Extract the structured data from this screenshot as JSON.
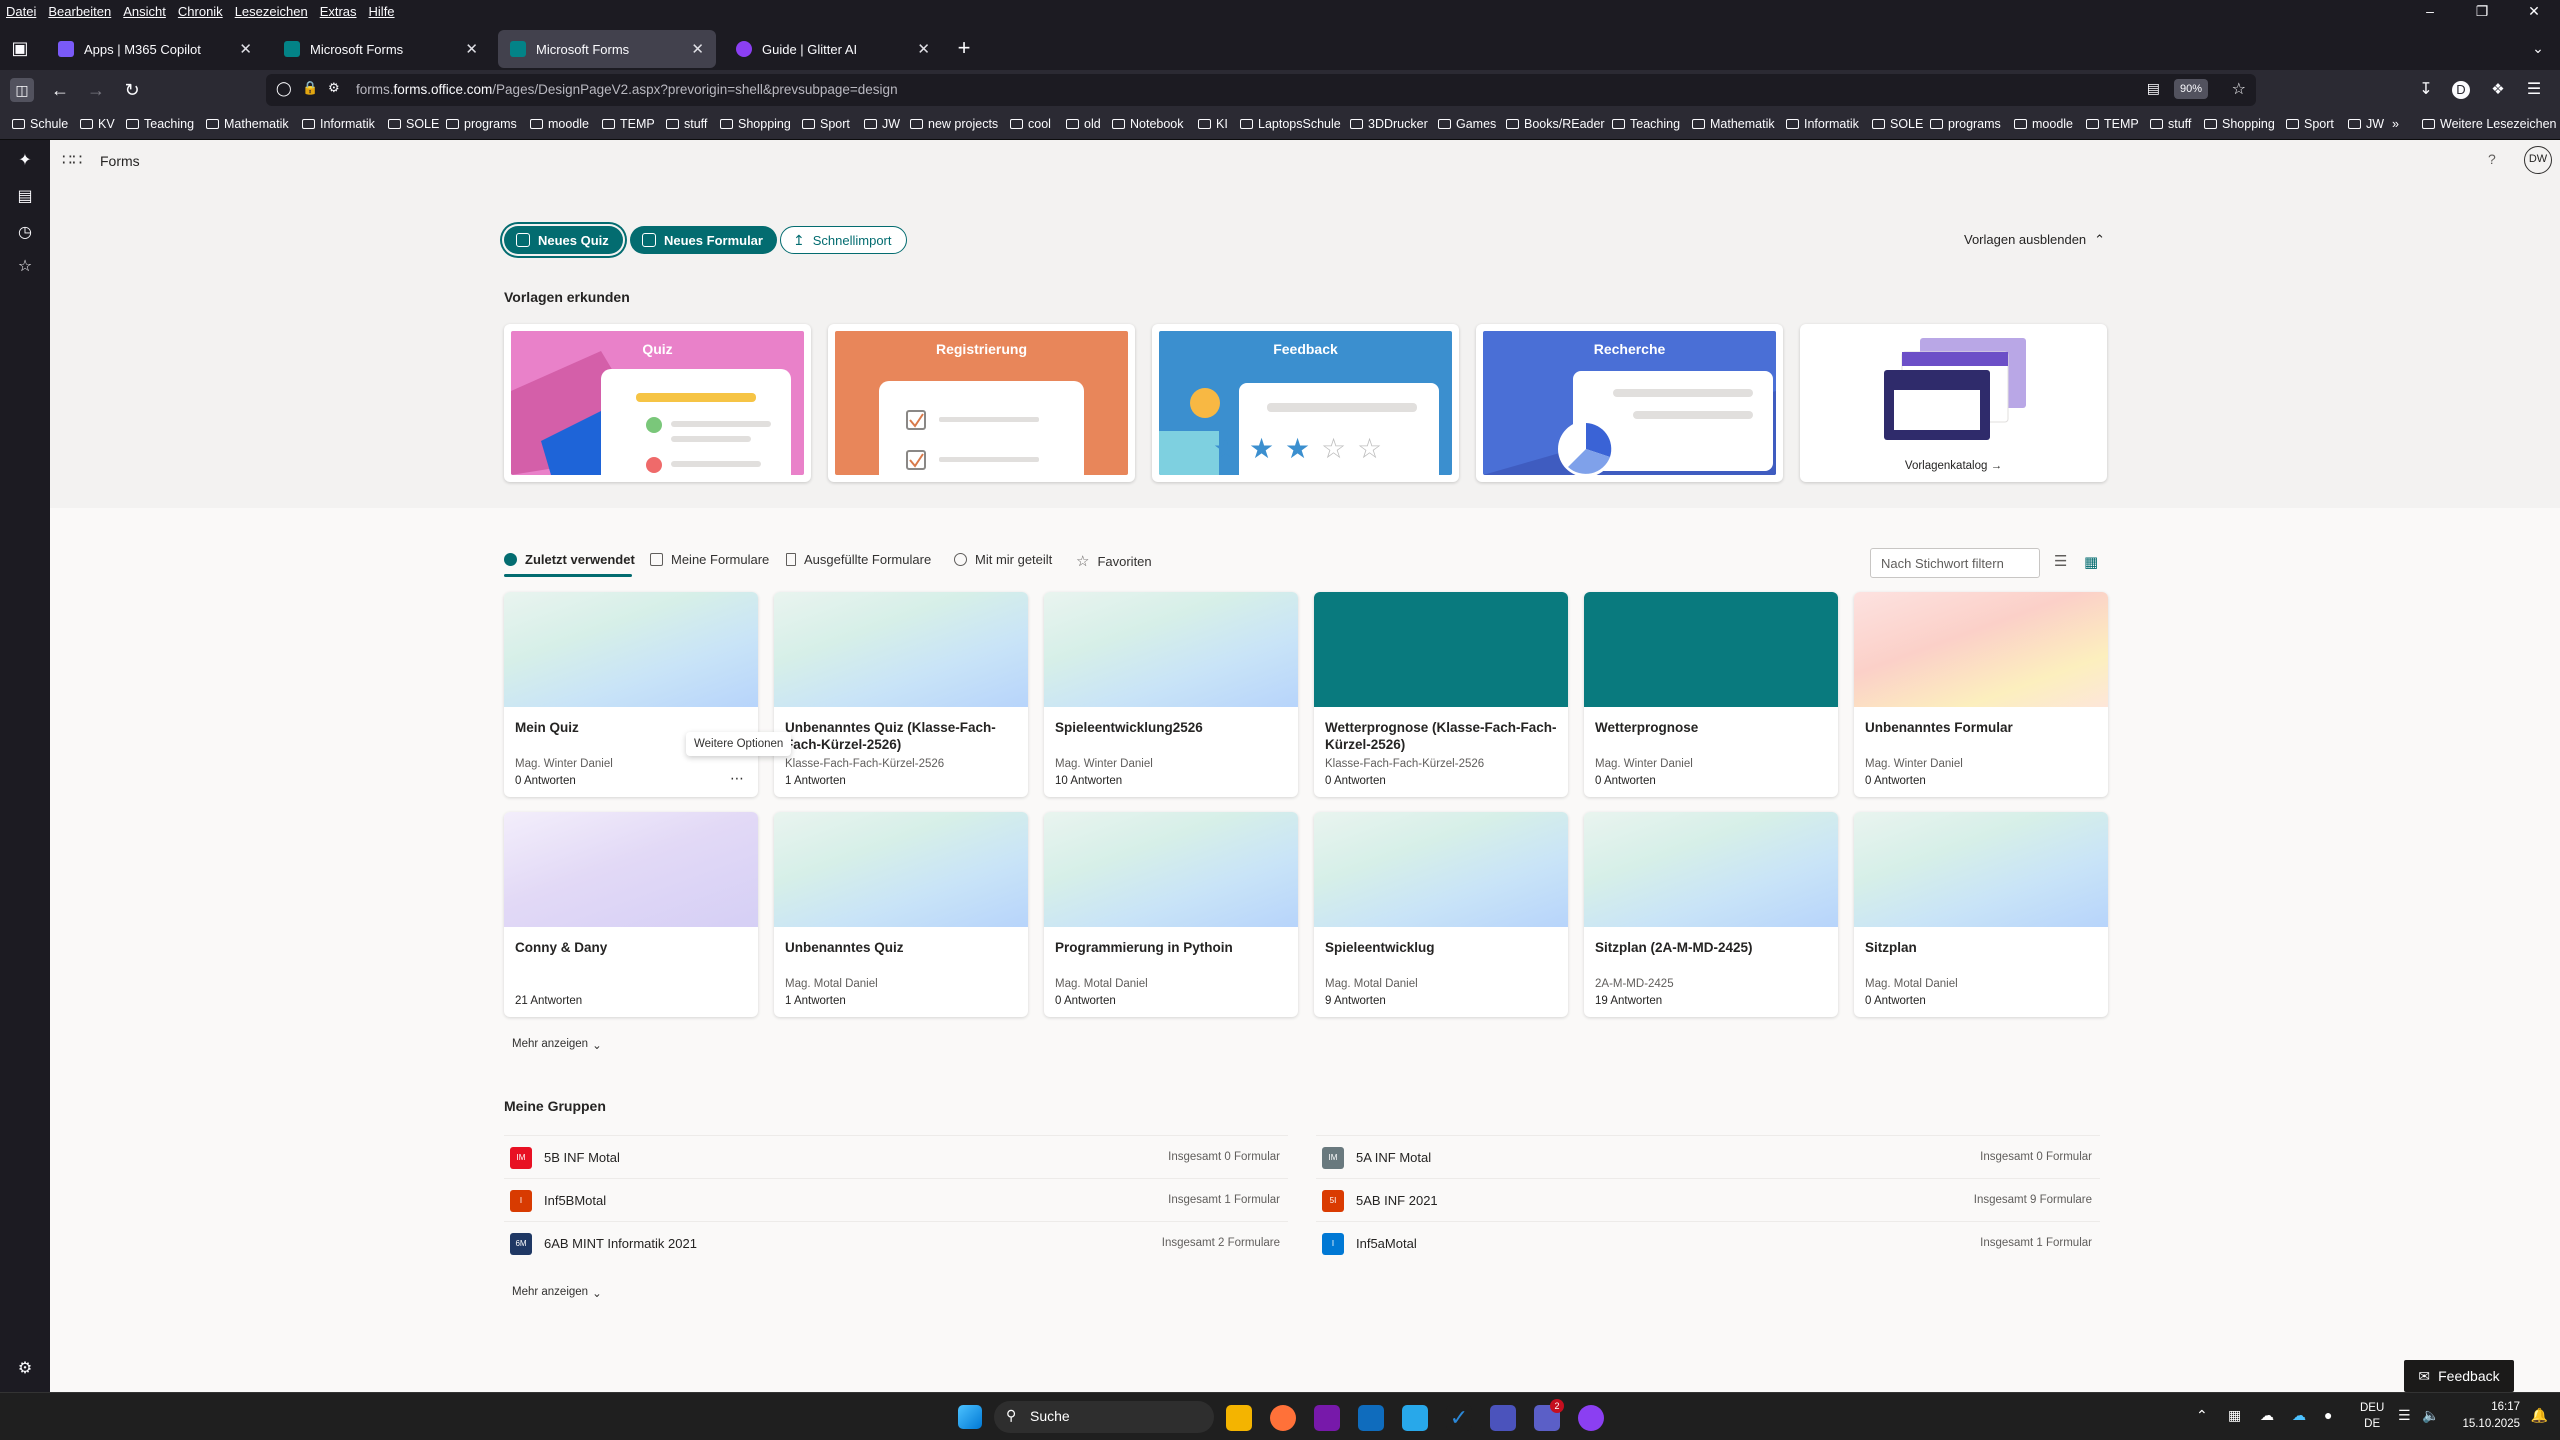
{
  "menu": [
    "Datei",
    "Bearbeiten",
    "Ansicht",
    "Chronik",
    "Lesezeichen",
    "Extras",
    "Hilfe"
  ],
  "tabs": [
    {
      "title": "Apps | M365 Copilot",
      "color": "#7a5af8"
    },
    {
      "title": "Microsoft Forms",
      "color": "#038387"
    },
    {
      "title": "Microsoft Forms",
      "color": "#038387",
      "active": true
    },
    {
      "title": "Guide | Glitter AI",
      "color": "#8b3ff2"
    }
  ],
  "url": {
    "host": "forms.office.com",
    "rest": "/Pages/DesignPageV2.aspx?prevorigin=shell&prevsubpage=design",
    "prefix": "forms.",
    "zoom": "90%"
  },
  "bookmarks": [
    "Schule",
    "KV",
    "Teaching",
    "Mathematik",
    "Informatik",
    "SOLE",
    "programs",
    "moodle",
    "TEMP",
    "stuff",
    "Shopping",
    "Sport",
    "JW",
    "new projects",
    "cool",
    "old",
    "Notebook",
    "KI",
    "LaptopsSchule",
    "3DDrucker",
    "Games",
    "Books/REader",
    "Teaching",
    "Mathematik",
    "Informatik",
    "SOLE",
    "programs",
    "moodle",
    "TEMP",
    "stuff",
    "Shopping",
    "Sport",
    "JW"
  ],
  "bookmarks_more": "Weitere Lesezeichen",
  "app": {
    "name": "Forms",
    "avatar": "DW",
    "help": "?"
  },
  "actions": {
    "new_quiz": "Neues Quiz",
    "new_form": "Neues Formular",
    "quick_import": "Schnellimport",
    "hide_templates": "Vorlagen ausblenden"
  },
  "templates_heading": "Vorlagen erkunden",
  "templates": [
    {
      "title": "Quiz",
      "color": "#e577c6"
    },
    {
      "title": "Registrierung",
      "color": "#e8865a"
    },
    {
      "title": "Feedback",
      "color": "#3b8fcf"
    },
    {
      "title": "Recherche",
      "color": "#4a6fd6"
    }
  ],
  "template_catalog": "Vorlagenkatalog",
  "filter_tabs": [
    "Zuletzt verwendet",
    "Meine Formulare",
    "Ausgefüllte Formulare",
    "Mit mir geteilt",
    "Favoriten"
  ],
  "filter_placeholder": "Nach Stichwort filtern",
  "forms": [
    {
      "title": "Mein Quiz",
      "owner": "Mag. Winter Daniel",
      "responses": "0 Antworten",
      "style": "g-mint"
    },
    {
      "title": "Unbenanntes Quiz (Klasse-Fach-Fach-Kürzel-2526)",
      "owner": "Klasse-Fach-Fach-Kürzel-2526",
      "responses": "1 Antworten",
      "style": "g-mint"
    },
    {
      "title": "Spieleentwicklung2526",
      "owner": "Mag. Winter Daniel",
      "responses": "10 Antworten",
      "style": "g-mint"
    },
    {
      "title": "Wetterprognose (Klasse-Fach-Fach-Kürzel-2526)",
      "owner": "Klasse-Fach-Fach-Kürzel-2526",
      "responses": "0 Antworten",
      "style": "g-teal"
    },
    {
      "title": "Wetterprognose",
      "owner": "Mag. Winter Daniel",
      "responses": "0 Antworten",
      "style": "g-teal"
    },
    {
      "title": "Unbenanntes Formular",
      "owner": "Mag. Winter Daniel",
      "responses": "0 Antworten",
      "style": "g-peach"
    },
    {
      "title": "Conny & Dany",
      "owner": "",
      "responses": "21 Antworten",
      "style": "g-lav"
    },
    {
      "title": "Unbenanntes Quiz",
      "owner": "Mag. Motal Daniel",
      "responses": "1 Antworten",
      "style": "g-mint"
    },
    {
      "title": "Programmierung in Pythoin",
      "owner": "Mag. Motal Daniel",
      "responses": "0 Antworten",
      "style": "g-mint"
    },
    {
      "title": "Spieleentwicklug",
      "owner": "Mag. Motal Daniel",
      "responses": "9 Antworten",
      "style": "g-mint"
    },
    {
      "title": "Sitzplan (2A-M-MD-2425)",
      "owner": "2A-M-MD-2425",
      "responses": "19 Antworten",
      "style": "g-mint"
    },
    {
      "title": "Sitzplan",
      "owner": "Mag. Motal Daniel",
      "responses": "0 Antworten",
      "style": "g-mint"
    }
  ],
  "more_options_tooltip": "Weitere Optionen",
  "show_more": "Mehr anzeigen",
  "groups_heading": "Meine Gruppen",
  "groups": [
    {
      "name": "5B INF Motal",
      "count": "Insgesamt 0 Formular",
      "color": "#e81123",
      "abbr": "IM"
    },
    {
      "name": "5A INF Motal",
      "count": "Insgesamt 0 Formular",
      "color": "#69797e",
      "abbr": "IM"
    },
    {
      "name": "Inf5BMotal",
      "count": "Insgesamt 1 Formular",
      "color": "#d83b01",
      "abbr": "I"
    },
    {
      "name": "5AB INF 2021",
      "count": "Insgesamt 9 Formulare",
      "color": "#da3b01",
      "abbr": "5I"
    },
    {
      "name": "6AB MINT Informatik 2021",
      "count": "Insgesamt 2 Formulare",
      "color": "#1f3864",
      "abbr": "6M"
    },
    {
      "name": "Inf5aMotal",
      "count": "Insgesamt 1 Formular",
      "color": "#0078d4",
      "abbr": "I"
    }
  ],
  "feedback": "Feedback",
  "taskbar": {
    "search": "Suche",
    "lang1": "DEU",
    "lang2": "DE",
    "time": "16:17",
    "date": "15.10.2025",
    "badge": "2"
  }
}
